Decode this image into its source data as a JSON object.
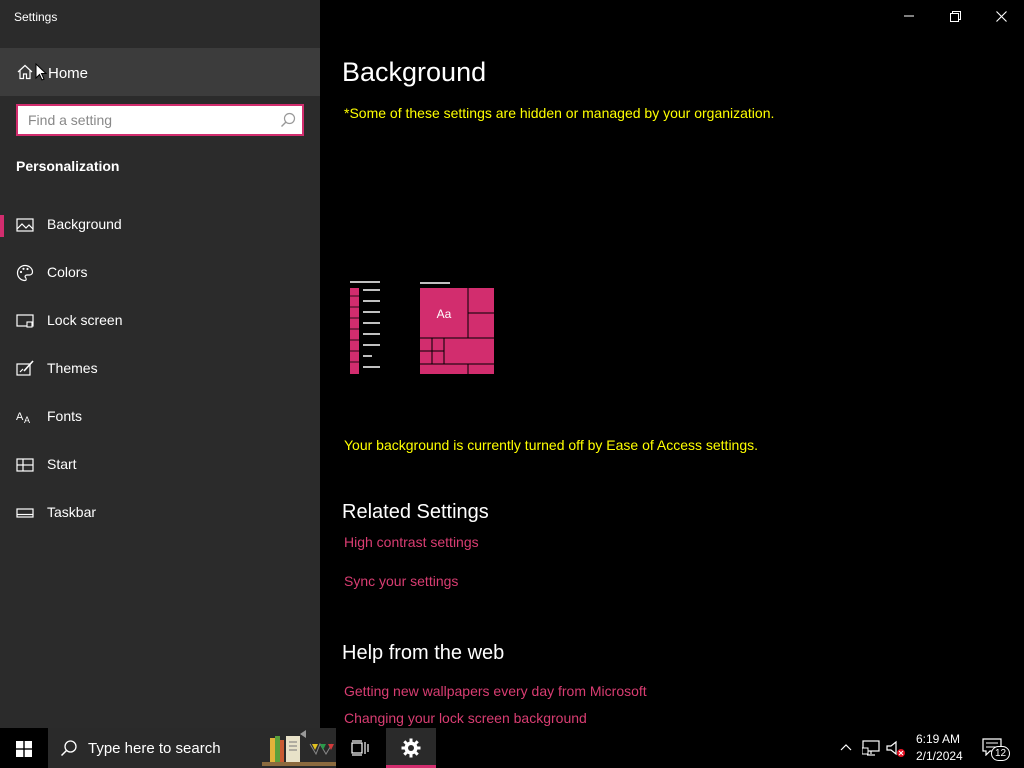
{
  "window": {
    "title": "Settings",
    "minimize_label": "Minimize",
    "maximize_label": "Restore",
    "close_label": "Close"
  },
  "sidebar": {
    "home_label": "Home",
    "search_placeholder": "Find a setting",
    "section": "Personalization",
    "items": [
      {
        "label": "Background",
        "icon": "picture-icon",
        "selected": true
      },
      {
        "label": "Colors",
        "icon": "palette-icon",
        "selected": false
      },
      {
        "label": "Lock screen",
        "icon": "lock-screen-icon",
        "selected": false
      },
      {
        "label": "Themes",
        "icon": "brush-icon",
        "selected": false
      },
      {
        "label": "Fonts",
        "icon": "font-icon",
        "selected": false
      },
      {
        "label": "Start",
        "icon": "start-icon",
        "selected": false
      },
      {
        "label": "Taskbar",
        "icon": "taskbar-icon",
        "selected": false
      }
    ]
  },
  "main": {
    "title": "Background",
    "org_notice": "*Some of these settings are hidden or managed by your organization.",
    "preview_tile_text": "Aa",
    "ease_notice": "Your background is currently turned off by Ease of Access settings.",
    "related_heading": "Related Settings",
    "related_links": [
      "High contrast settings",
      "Sync your settings"
    ],
    "help_heading": "Help from the web",
    "help_links": [
      "Getting new wallpapers every day from Microsoft",
      "Changing your lock screen background"
    ]
  },
  "taskbar": {
    "search_text": "Type here to search",
    "time": "6:19 AM",
    "date": "2/1/2024",
    "notification_count": "12"
  },
  "colors": {
    "accent": "#d22d6e",
    "link": "#d93d72",
    "notice": "#ffff00",
    "sidebar_bg": "#2b2b2b"
  }
}
